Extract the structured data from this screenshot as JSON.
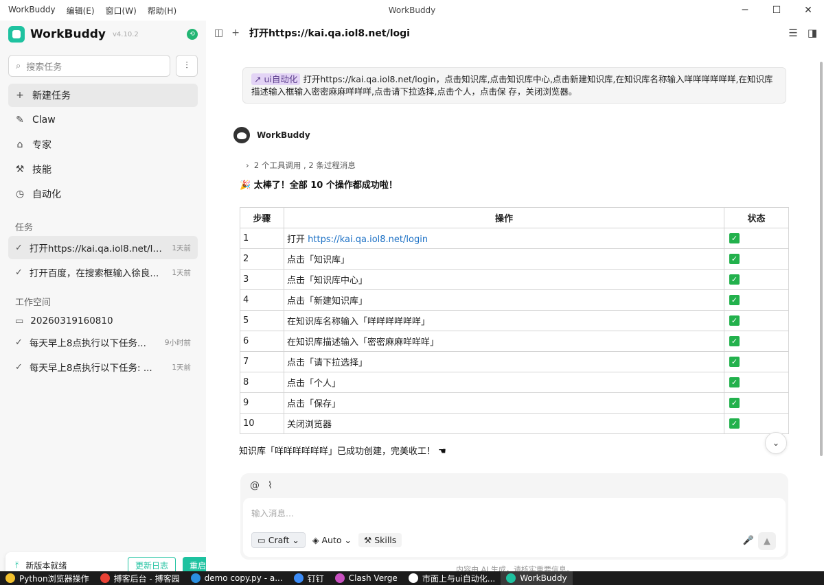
{
  "window": {
    "title": "WorkBuddy",
    "menu": [
      "WorkBuddy",
      "编辑(E)",
      "窗口(W)",
      "帮助(H)"
    ]
  },
  "sidebar": {
    "brand": "WorkBuddy",
    "version": "v4.10.2",
    "search_placeholder": "搜索任务",
    "nav": [
      {
        "label": "新建任务",
        "icon": "plus-icon"
      },
      {
        "label": "Claw",
        "icon": "claw-icon"
      },
      {
        "label": "专家",
        "icon": "graduation-cap-icon"
      },
      {
        "label": "技能",
        "icon": "skills-icon"
      },
      {
        "label": "自动化",
        "icon": "clock-icon"
      }
    ],
    "tasks_header": "任务",
    "tasks": [
      {
        "title": "打开https://kai.qa.iol8.net/logi",
        "time": "1天前"
      },
      {
        "title": "打开百度，在搜索框输入徐良...",
        "time": "1天前"
      }
    ],
    "workspace_header": "工作空间",
    "workspace_folder": "20260319160810",
    "workspace_tasks": [
      {
        "title": "每天早上8点执行以下任务...",
        "time": "9小时前"
      },
      {
        "title": "每天早上8点执行以下任务: ...",
        "time": "1天前"
      }
    ],
    "update": {
      "text": "新版本就绪",
      "changelog": "更新日志",
      "restart": "重启升级"
    }
  },
  "main": {
    "title": "打开https://kai.qa.iol8.net/logi",
    "user_tag": "ui自动化",
    "user_message": "打开https://kai.qa.iol8.net/login，点击知识库,点击知识库中心,点击新建知识库,在知识库名称输入咩咩咩咩咩咩,在知识库描述输入框输入密密麻麻咩咩咩,点击请下拉选择,点击个人，点击保 存，关闭浏览器。",
    "bot_name": "WorkBuddy",
    "tool_summary": "2 个工具调用 , 2 条过程消息",
    "success_text": "太棒了！全部 10 个操作都成功啦！",
    "table": {
      "headers": [
        "步骤",
        "操作",
        "状态"
      ],
      "rows": [
        {
          "step": "1",
          "prefix": "打开 ",
          "link": "https://kai.qa.iol8.net/login",
          "action": ""
        },
        {
          "step": "2",
          "prefix": "",
          "link": "",
          "action": "点击「知识库」"
        },
        {
          "step": "3",
          "prefix": "",
          "link": "",
          "action": "点击「知识库中心」"
        },
        {
          "step": "4",
          "prefix": "",
          "link": "",
          "action": "点击「新建知识库」"
        },
        {
          "step": "5",
          "prefix": "",
          "link": "",
          "action": "在知识库名称输入「咩咩咩咩咩咩」"
        },
        {
          "step": "6",
          "prefix": "",
          "link": "",
          "action": "在知识库描述输入「密密麻麻咩咩咩」"
        },
        {
          "step": "7",
          "prefix": "",
          "link": "",
          "action": "点击「请下拉选择」"
        },
        {
          "step": "8",
          "prefix": "",
          "link": "",
          "action": "点击「个人」"
        },
        {
          "step": "9",
          "prefix": "",
          "link": "",
          "action": "点击「保存」"
        },
        {
          "step": "10",
          "prefix": "",
          "link": "",
          "action": "关闭浏览器"
        }
      ]
    },
    "done_text": "知识库「咩咩咩咩咩咩」已成功创建，完美收工！",
    "composer": {
      "placeholder": "输入消息...",
      "mode": "Craft",
      "model": "Auto",
      "skills": "Skills"
    },
    "disclaimer": "内容由 AI 生成，请核实重要信息。"
  },
  "taskbar": [
    {
      "label": "Python浏览器操作",
      "color": "#f2c12e"
    },
    {
      "label": "搏客后台 - 搏客园",
      "color": "#e94235"
    },
    {
      "label": "demo copy.py - a...",
      "color": "#2a8fe0"
    },
    {
      "label": "钉钉",
      "color": "#3c8cf7"
    },
    {
      "label": "Clash Verge",
      "color": "#c850c0"
    },
    {
      "label": "市面上与ui自动化...",
      "color": "#ffffff"
    },
    {
      "label": "WorkBuddy",
      "color": "#1ec2a0"
    }
  ]
}
